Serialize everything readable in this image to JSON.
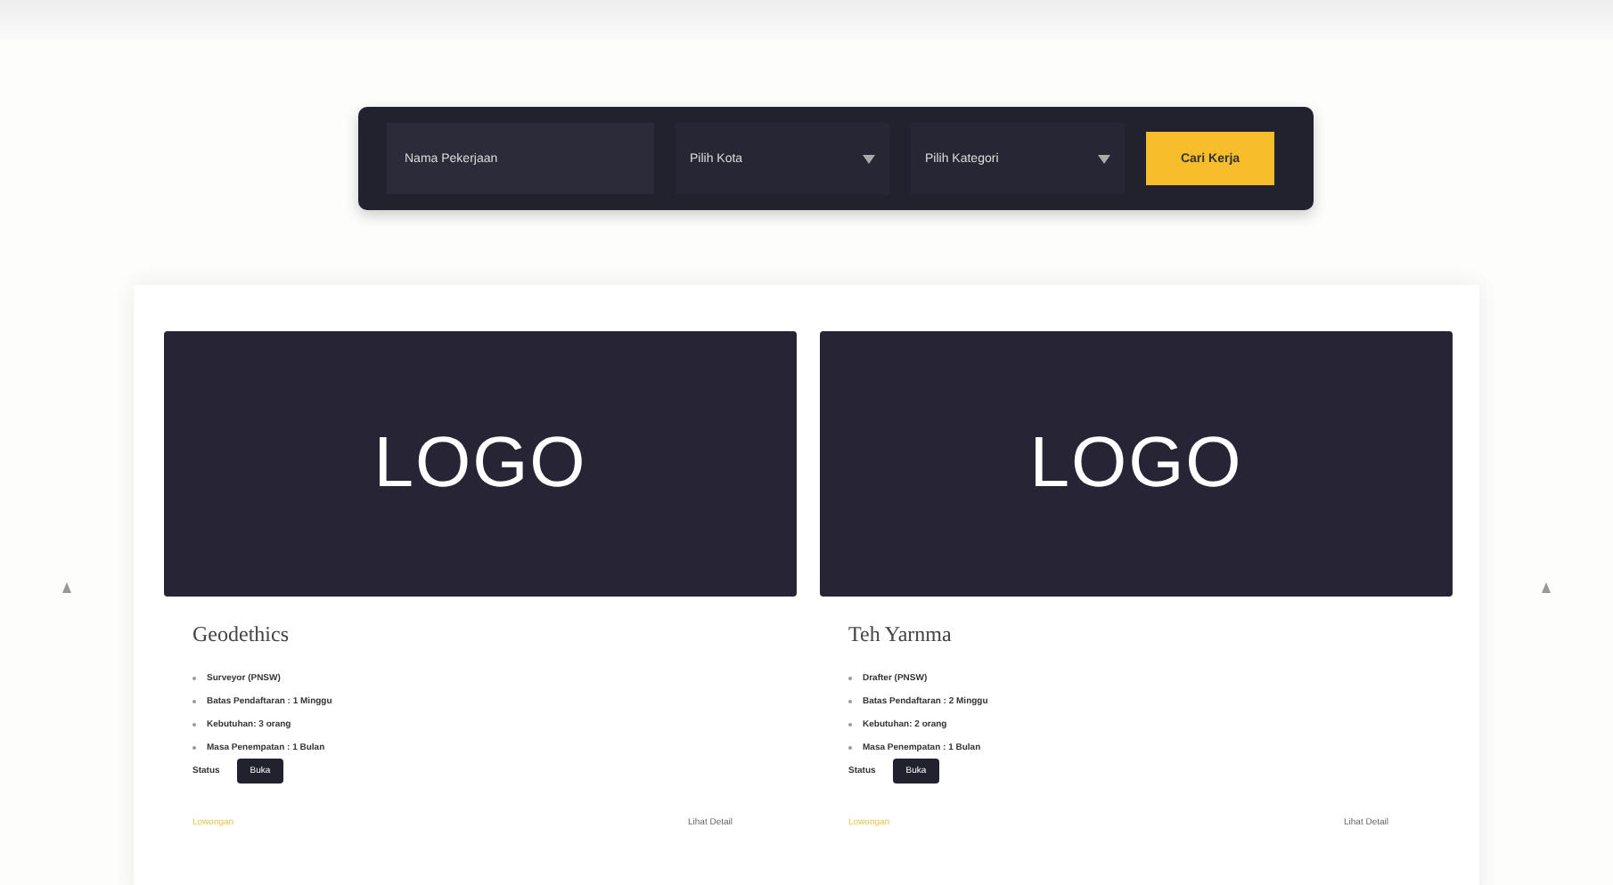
{
  "search": {
    "keyword_placeholder": "Nama Pekerjaan",
    "city": "Pilih Kota",
    "category": "Pilih Kategori",
    "button": "Cari Kerja"
  },
  "cards": [
    {
      "logo": "LOGO",
      "title": "Geodethics",
      "details": [
        "Surveyor (PNSW)",
        "Batas Pendaftaran : 1 Minggu",
        "Kebutuhan: 3 orang",
        "Masa Penempatan : 1 Bulan"
      ],
      "status_label": "Status",
      "status_button": "Buka",
      "footer_left": "Lowongan",
      "footer_right": "Lihat Detail"
    },
    {
      "logo": "LOGO",
      "title": "Teh Yarnma",
      "details": [
        "Drafter (PNSW)",
        "Batas Pendaftaran : 2 Minggu",
        "Kebutuhan: 2 orang",
        "Masa Penempatan : 1 Bulan"
      ],
      "status_label": "Status",
      "status_button": "Buka",
      "footer_left": "Lowongan",
      "footer_right": "Lihat Detail"
    }
  ]
}
